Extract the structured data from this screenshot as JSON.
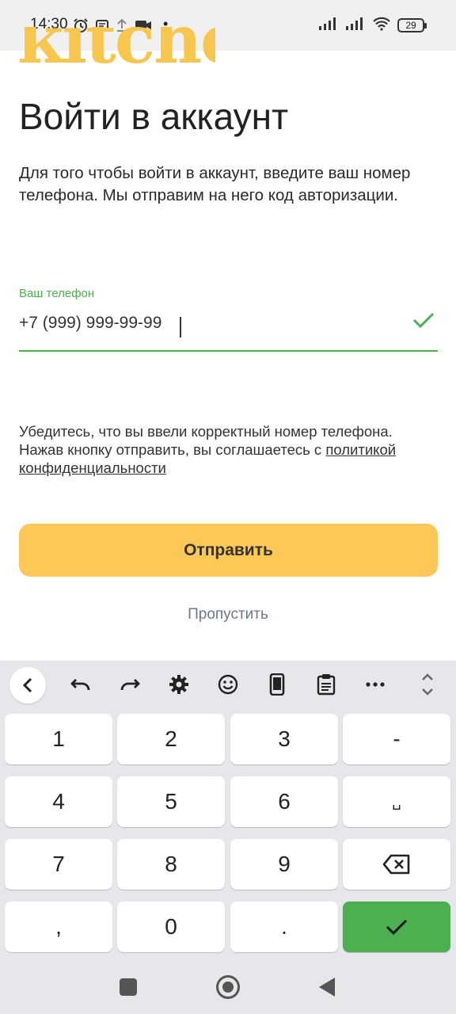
{
  "status_bar": {
    "time": "14:30",
    "battery": "29",
    "dot": "•"
  },
  "logo": {
    "text": "kitchen."
  },
  "page": {
    "title": "Войти в аккаунт",
    "description": "Для того чтобы войти в аккаунт, введите ваш номер телефона. Мы отправим на него код авторизации."
  },
  "phone_field": {
    "label": "Ваш телефон",
    "value": "+7 (999) 999-99-99"
  },
  "notice": {
    "text": "Убедитесь, что вы ввели корректный номер телефона. Нажав кнопку отправить, вы соглашаетесь с ",
    "link": "политикой конфиденциальности"
  },
  "actions": {
    "send_label": "Отправить",
    "skip_label": "Пропустить"
  },
  "keyboard": {
    "toolbar": [
      "chevron-left-icon",
      "undo-icon",
      "redo-icon",
      "gear-icon",
      "smile-icon",
      "phone-icon",
      "clipboard-icon",
      "more-icon",
      "resize-icon"
    ],
    "keys": {
      "k1": "1",
      "k2": "2",
      "k3": "3",
      "dash": "-",
      "k4": "4",
      "k5": "5",
      "k6": "6",
      "space": "␣",
      "k7": "7",
      "k8": "8",
      "k9": "9",
      "comma": ",",
      "k0": "0",
      "period": "."
    }
  },
  "colors": {
    "accent_yellow": "#fec858",
    "logo_yellow": "#f6c64f",
    "success_green": "#4caf50",
    "muted_text": "#6e7783"
  }
}
